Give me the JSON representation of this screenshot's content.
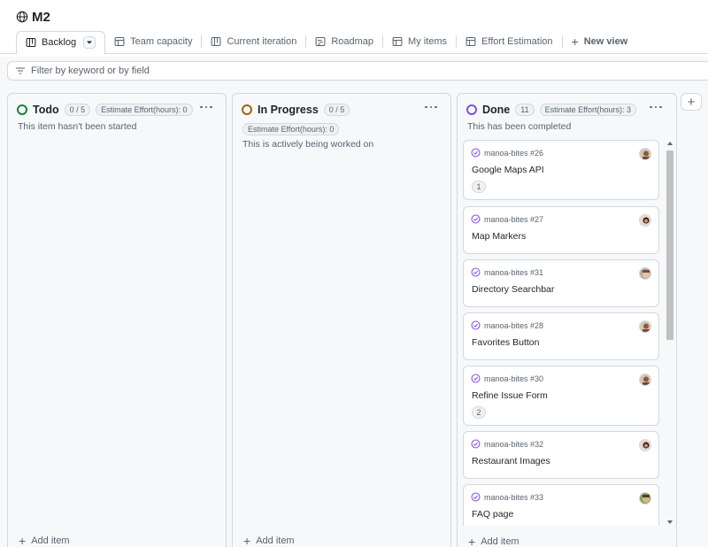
{
  "project": {
    "title": "M2",
    "globe_icon": "globe-icon"
  },
  "tabs": [
    {
      "label": "Backlog",
      "icon": "board-icon",
      "active": true
    },
    {
      "label": "Team capacity",
      "icon": "table-icon"
    },
    {
      "label": "Current iteration",
      "icon": "board-icon"
    },
    {
      "label": "Roadmap",
      "icon": "roadmap-icon"
    },
    {
      "label": "My items",
      "icon": "table-icon"
    },
    {
      "label": "Effort Estimation",
      "icon": "table-icon"
    }
  ],
  "new_view_label": "New view",
  "filter": {
    "placeholder": "Filter by keyword or by field"
  },
  "columns": [
    {
      "name": "Todo",
      "count": "0 / 5",
      "estimate": "Estimate Effort(hours): 0",
      "description": "This item hasn't been started",
      "color": "#1a7f37",
      "add_label": "Add item"
    },
    {
      "name": "In Progress",
      "count": "0 / 5",
      "estimate": "Estimate Effort(hours): 0",
      "description": "This is actively being worked on",
      "color": "#9a6700",
      "add_label": "Add item"
    },
    {
      "name": "Done",
      "count": "11",
      "estimate": "Estimate Effort(hours): 3",
      "description": "This has been completed",
      "color": "#8250df",
      "add_label": "Add item",
      "cards": [
        {
          "ref": "manoa-bites #26",
          "title": "Google Maps API",
          "estimate": "1",
          "avatar": "avatar-a"
        },
        {
          "ref": "manoa-bites #27",
          "title": "Map Markers",
          "avatar": "avatar-b"
        },
        {
          "ref": "manoa-bites #31",
          "title": "Directory Searchbar",
          "avatar": "avatar-c"
        },
        {
          "ref": "manoa-bites #28",
          "title": "Favorites Button",
          "avatar": "avatar-a"
        },
        {
          "ref": "manoa-bites #30",
          "title": "Refine Issue Form",
          "estimate": "2",
          "avatar": "avatar-a"
        },
        {
          "ref": "manoa-bites #32",
          "title": "Restaurant Images",
          "avatar": "avatar-b"
        },
        {
          "ref": "manoa-bites #33",
          "title": "FAQ page",
          "avatar": "avatar-d"
        }
      ]
    }
  ],
  "colors": {
    "accent_done": "#8250df",
    "accent_todo": "#1a7f37",
    "accent_progress": "#9a6700",
    "border": "#d1d9e0",
    "muted": "#59636e"
  }
}
